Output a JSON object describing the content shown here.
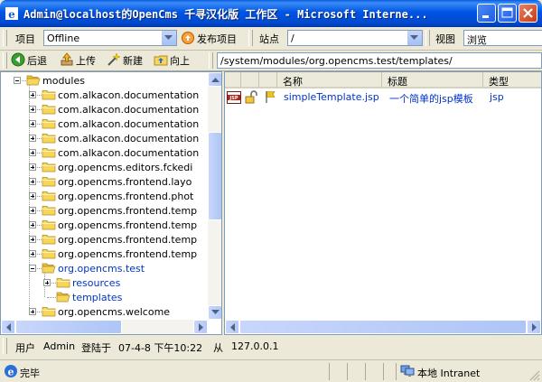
{
  "window": {
    "title": "Admin@localhost的OpenCms 千寻汉化版 工作区 - Microsoft Interne...",
    "title_color": "#ffffff",
    "titlebar_color": "#0054e3"
  },
  "toolbar": {
    "project_label": "项目",
    "project_value": "Offline",
    "publish_label": "发布项目",
    "site_label": "站点",
    "site_value": "/",
    "view_label": "视图",
    "view_value": "浏览"
  },
  "nav": {
    "back_label": "后退",
    "upload_label": "上传",
    "new_label": "新建",
    "up_label": "向上",
    "path": "/system/modules/org.opencms.test/templates/"
  },
  "tree": {
    "items": [
      {
        "label": "modules",
        "expander": "minus",
        "state": "open"
      },
      {
        "label": "com.alkacon.documentation",
        "expander": "plus"
      },
      {
        "label": "com.alkacon.documentation",
        "expander": "plus"
      },
      {
        "label": "com.alkacon.documentation",
        "expander": "plus"
      },
      {
        "label": "com.alkacon.documentation",
        "expander": "plus"
      },
      {
        "label": "com.alkacon.documentation",
        "expander": "plus"
      },
      {
        "label": "org.opencms.editors.fckedi",
        "expander": "plus"
      },
      {
        "label": "org.opencms.frontend.layo",
        "expander": "plus"
      },
      {
        "label": "org.opencms.frontend.phot",
        "expander": "plus"
      },
      {
        "label": "org.opencms.frontend.temp",
        "expander": "plus"
      },
      {
        "label": "org.opencms.frontend.temp",
        "expander": "plus"
      },
      {
        "label": "org.opencms.frontend.temp",
        "expander": "plus"
      },
      {
        "label": "org.opencms.frontend.temp",
        "expander": "plus"
      },
      {
        "label": "org.opencms.test",
        "expander": "minus",
        "state": "open",
        "link": true
      },
      {
        "label": "resources",
        "expander": "plus",
        "link": true
      },
      {
        "label": "templates",
        "expander": "none",
        "state": "open",
        "link": true
      },
      {
        "label": "org.opencms.welcome",
        "expander": "plus"
      }
    ]
  },
  "list": {
    "columns": [
      "名称",
      "标题",
      "类型"
    ],
    "rows": [
      {
        "name": "simpleTemplate.jsp",
        "title": "一个简单的jsp模板",
        "type": "jsp",
        "icon": "jsp-file-icon"
      }
    ]
  },
  "info": {
    "user_label": "用户",
    "user": "Admin",
    "login_label": "登陆于",
    "login_time": "07-4-8 下午10:22",
    "from_label": "从",
    "ip": "127.0.0.1"
  },
  "status": {
    "text": "完毕",
    "zone": "本地 Intranet"
  },
  "colors": {
    "link": "#0033cc",
    "folder": "#f7d65e"
  }
}
